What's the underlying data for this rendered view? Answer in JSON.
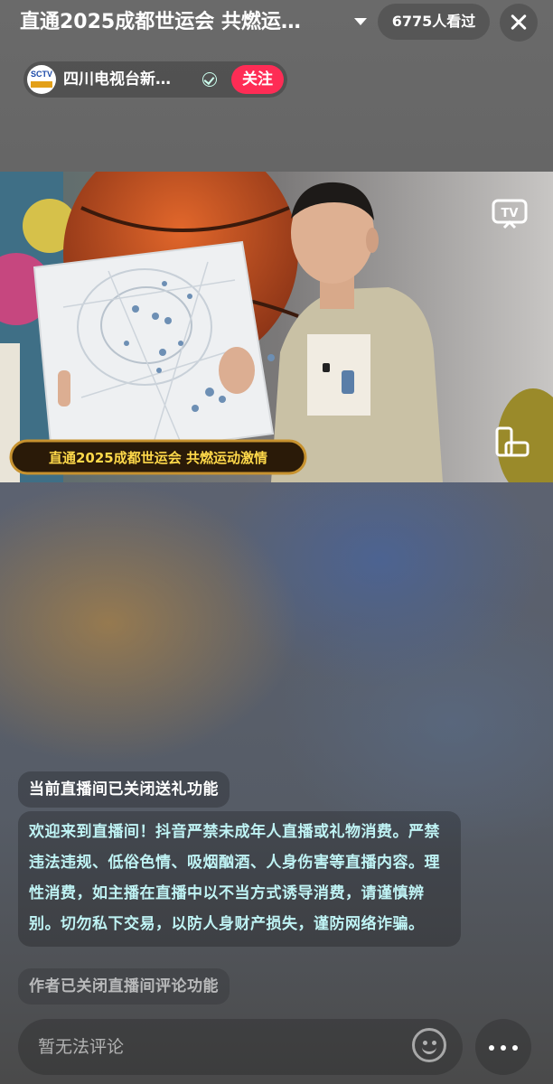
{
  "header": {
    "title": "直通2025成都世运会 共燃运…",
    "viewers": "6775人看过"
  },
  "anchor": {
    "logo_text": "SCTV",
    "name": "四川电视台新…",
    "follow_label": "关注"
  },
  "video": {
    "caption": "直通2025成都世运会 共燃运动激情",
    "tv_label": "TV"
  },
  "chat": {
    "messages": [
      "当前直播间已关闭送礼功能",
      "欢迎来到直播间！抖音严禁未成年人直播或礼物消费。严禁违法违规、低俗色情、吸烟酗酒、人身伤害等直播内容。理性消费，如主播在直播中以不当方式诱导消费，请谨慎辨别。切勿私下交易，以防人身财产损失，谨防网络诈骗。",
      "作者已关闭直播间评论功能"
    ]
  },
  "comment_bar": {
    "placeholder": "暂无法评论"
  },
  "colors": {
    "follow": "#fe2c55",
    "notice_text": "#bff3f4",
    "caption_text": "#ffd94a"
  },
  "icons": [
    "dropdown-caret-icon",
    "close-icon",
    "verified-icon",
    "tv-icon",
    "rotate-screen-icon",
    "emoji-icon",
    "more-icon"
  ]
}
